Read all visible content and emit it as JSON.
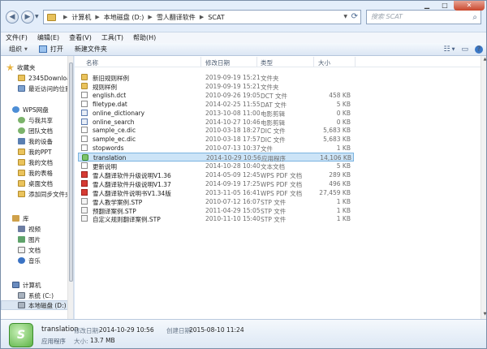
{
  "address": {
    "crumbs": [
      "计算机",
      "本地磁盘 (D:)",
      "雪人翻译软件",
      "SCAT"
    ]
  },
  "search": {
    "placeholder": "搜索 SCAT"
  },
  "menu": [
    "文件(F)",
    "编辑(E)",
    "查看(V)",
    "工具(T)",
    "帮助(H)"
  ],
  "toolbar": {
    "organize": "组织",
    "open": "打开",
    "new_folder": "新建文件夹"
  },
  "sidebar": {
    "items": [
      {
        "label": "收藏夹",
        "icon": "star-icon"
      },
      {
        "label": "2345Downloads",
        "icon": "folder-icon"
      },
      {
        "label": "最近访问的位置",
        "icon": "recent-places-icon"
      },
      {
        "label": "WPS网盘",
        "icon": "cloud-icon"
      },
      {
        "label": "与我共享",
        "icon": "share-icon"
      },
      {
        "label": "团队文档",
        "icon": "team-icon"
      },
      {
        "label": "我的设备",
        "icon": "device-icon"
      },
      {
        "label": "我的PPT",
        "icon": "folder-icon"
      },
      {
        "label": "我的文档",
        "icon": "folder-icon"
      },
      {
        "label": "我的表格",
        "icon": "folder-icon"
      },
      {
        "label": "桌面文档",
        "icon": "folder-icon"
      },
      {
        "label": "添加同步文件夹",
        "icon": "folder-icon"
      },
      {
        "label": "库",
        "icon": "library-icon"
      },
      {
        "label": "视频",
        "icon": "video-icon"
      },
      {
        "label": "图片",
        "icon": "picture-icon"
      },
      {
        "label": "文档",
        "icon": "document-icon"
      },
      {
        "label": "音乐",
        "icon": "music-icon"
      },
      {
        "label": "计算机",
        "icon": "computer-icon"
      },
      {
        "label": "系统 (C:)",
        "icon": "drive-icon"
      },
      {
        "label": "本地磁盘 (D:)",
        "icon": "drive-icon"
      }
    ]
  },
  "columns": {
    "name": "名称",
    "date": "修改日期",
    "type": "类型",
    "size": "大小"
  },
  "files": [
    {
      "name": "新旧规则样例",
      "date": "2019-09-19 15:21",
      "type": "文件夹",
      "size": "",
      "icon": "folder-icon"
    },
    {
      "name": "规则样例",
      "date": "2019-09-19 15:21",
      "type": "文件夹",
      "size": "",
      "icon": "folder-icon"
    },
    {
      "name": "english.dct",
      "date": "2010-09-26 19:05",
      "type": "DCT 文件",
      "size": "458 KB",
      "icon": "document-icon"
    },
    {
      "name": "filetype.dat",
      "date": "2014-02-25 11:55",
      "type": "DAT 文件",
      "size": "5 KB",
      "icon": "document-icon"
    },
    {
      "name": "online_dictionary",
      "date": "2013-10-08 11:00",
      "type": "电影剪辑",
      "size": "0 KB",
      "icon": "media-icon"
    },
    {
      "name": "online_search",
      "date": "2014-10-27 10:46",
      "type": "电影剪辑",
      "size": "0 KB",
      "icon": "media-icon"
    },
    {
      "name": "sample_ce.dic",
      "date": "2010-03-18 18:27",
      "type": "DIC 文件",
      "size": "5,683 KB",
      "icon": "document-icon"
    },
    {
      "name": "sample_ec.dic",
      "date": "2010-03-18 17:57",
      "type": "DIC 文件",
      "size": "5,683 KB",
      "icon": "document-icon"
    },
    {
      "name": "stopwords",
      "date": "2010-07-13 10:37",
      "type": "文件",
      "size": "1 KB",
      "icon": "document-icon"
    },
    {
      "name": "translation",
      "date": "2014-10-29 10:56",
      "type": "应用程序",
      "size": "14,106 KB",
      "icon": "app-icon"
    },
    {
      "name": "更新说明",
      "date": "2014-10-28 10:40",
      "type": "文本文档",
      "size": "5 KB",
      "icon": "document-icon"
    },
    {
      "name": "雪人翻译软件升级说明V1.36",
      "date": "2014-05-09 12:45",
      "type": "WPS PDF 文档",
      "size": "289 KB",
      "icon": "pdf-icon"
    },
    {
      "name": "雪人翻译软件升级说明V1.37",
      "date": "2014-09-19 17:25",
      "type": "WPS PDF 文档",
      "size": "496 KB",
      "icon": "pdf-icon"
    },
    {
      "name": "雪人翻译软件说明书V1.34版",
      "date": "2013-11-05 16:41",
      "type": "WPS PDF 文档",
      "size": "27,459 KB",
      "icon": "pdf-icon"
    },
    {
      "name": "雪人教学案例.STP",
      "date": "2010-07-12 16:07",
      "type": "STP 文件",
      "size": "1 KB",
      "icon": "stp-icon"
    },
    {
      "name": "预翻译案例.STP",
      "date": "2011-04-29 15:05",
      "type": "STP 文件",
      "size": "1 KB",
      "icon": "stp-icon"
    },
    {
      "name": "自定义规则翻译案例.STP",
      "date": "2010-11-10 15:40",
      "type": "STP 文件",
      "size": "1 KB",
      "icon": "stp-icon"
    }
  ],
  "details": {
    "name": "translation",
    "type": "应用程序",
    "modified_label": "修改日期:",
    "modified_value": "2014-10-29 10:56",
    "size_label": "大小:",
    "size_value": "13.7 MB",
    "created_label": "创建日期:",
    "created_value": "2015-08-10 11:24"
  }
}
